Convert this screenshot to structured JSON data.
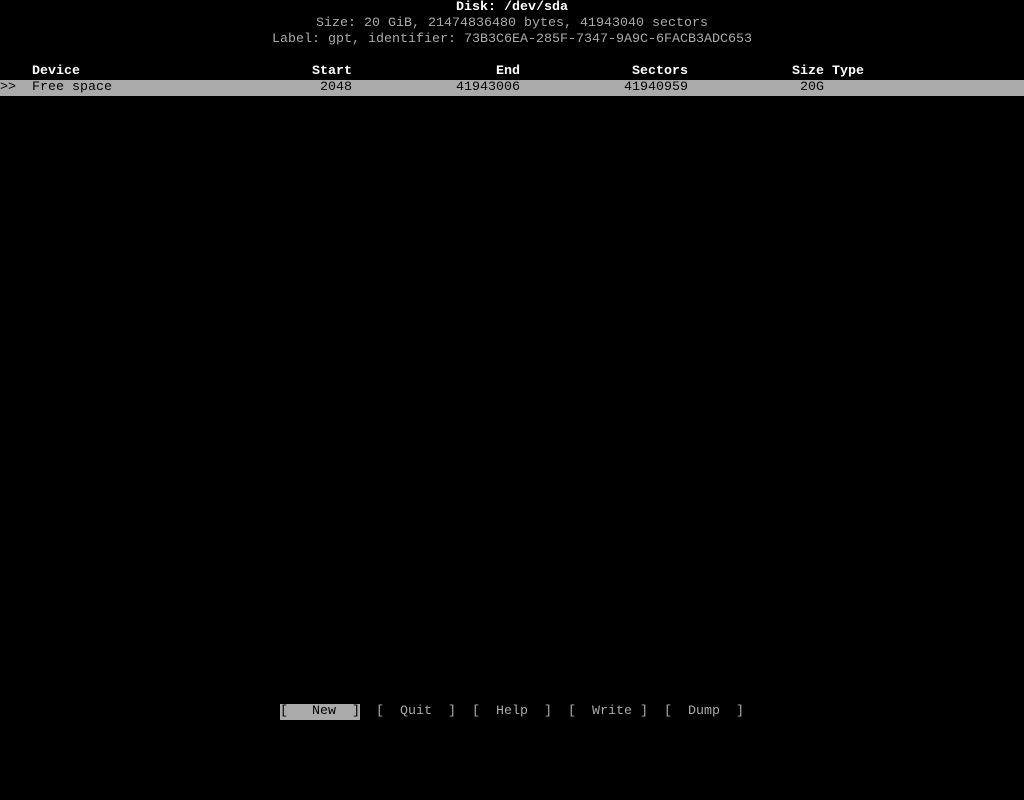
{
  "header": {
    "title": "Disk: /dev/sda",
    "size_line": "Size: 20 GiB, 21474836480 bytes, 41943040 sectors",
    "label_line": "Label: gpt, identifier: 73B3C6EA-285F-7347-9A9C-6FACB3ADC653"
  },
  "table": {
    "columns": {
      "device": "Device",
      "start": "Start",
      "end": "End",
      "sectors": "Sectors",
      "size": "Size",
      "type": "Type"
    },
    "rows": [
      {
        "marker": ">>",
        "device": "Free space",
        "start": "2048",
        "end": "41943006",
        "sectors": "41940959",
        "size": "20G",
        "type": "",
        "selected": true
      }
    ]
  },
  "menu": {
    "buttons": [
      {
        "label": "[   New  ]",
        "active": true
      },
      {
        "label": "[  Quit  ]",
        "active": false
      },
      {
        "label": "[  Help  ]",
        "active": false
      },
      {
        "label": "[  Write ]",
        "active": false
      },
      {
        "label": "[  Dump  ]",
        "active": false
      }
    ]
  },
  "colors": {
    "background": "#000000",
    "text": "#aaaaaa",
    "highlight": "#aaaaaa"
  }
}
